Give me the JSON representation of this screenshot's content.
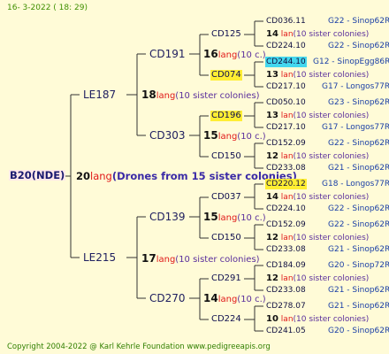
{
  "header": {
    "date": "16-  3-2022 ( 18: 29)"
  },
  "footer": {
    "copyright": "Copyright 2004-2022 @ Karl Kehrle Foundation   www.pedigreeapis.org"
  },
  "root": {
    "label": "B20(NDE)"
  },
  "root_mating": {
    "num": "20",
    "lang": "lang",
    "detail": "(Drones from 15 sister colonies)"
  },
  "parents": {
    "top": {
      "label": "LE187",
      "num": "18",
      "lang": "lang",
      "detail": "(10 sister colonies)"
    },
    "bottom": {
      "label": "LE215",
      "num": "17",
      "lang": "lang",
      "detail": "(10 sister colonies)"
    }
  },
  "grandparents": [
    {
      "label": "CD191",
      "num": "16",
      "lang": "lang",
      "detail": "(10 c.)"
    },
    {
      "label": "CD303",
      "num": "15",
      "lang": "lang",
      "detail": "(10 c.)"
    },
    {
      "label": "CD139",
      "num": "15",
      "lang": "lang",
      "detail": "(10 c.)"
    },
    {
      "label": "CD270",
      "num": "14",
      "lang": "lang",
      "detail": "(10 c.)"
    }
  ],
  "great_grandparents": [
    {
      "label": "CD125",
      "num": "14",
      "lang": "lan",
      "detail": "(10 sister colonies)"
    },
    {
      "label": "CD074",
      "num": "13",
      "lang": "lan",
      "detail": "(10 sister colonies)"
    },
    {
      "label": "CD196",
      "num": "13",
      "lang": "lan",
      "detail": "(10 sister colonies)"
    },
    {
      "label": "CD150",
      "num": "12",
      "lang": "lan",
      "detail": "(10 sister colonies)"
    },
    {
      "label": "CD037",
      "num": "14",
      "lang": "lan",
      "detail": "(10 sister colonies)"
    },
    {
      "label": "CD150",
      "num": "12",
      "lang": "lan",
      "detail": "(10 sister colonies)"
    },
    {
      "label": "CD291",
      "num": "12",
      "lang": "lan",
      "detail": "(10 sister colonies)"
    },
    {
      "label": "CD224",
      "num": "10",
      "lang": "lan",
      "detail": "(10 sister colonies)"
    }
  ],
  "gen4": [
    {
      "label": "CD036.11",
      "info": "G22 - Sinop62R"
    },
    {
      "label": "CD224.10",
      "info": "G22 - Sinop62R"
    },
    {
      "label": "CD244.10",
      "info": "G12 - SinopEgg86R"
    },
    {
      "label": "CD217.10",
      "info": "G17 - Longos77R"
    },
    {
      "label": "CD050.10",
      "info": "G23 - Sinop62R"
    },
    {
      "label": "CD217.10",
      "info": "G17 - Longos77R"
    },
    {
      "label": "CD152.09",
      "info": "G22 - Sinop62R"
    },
    {
      "label": "CD233.08",
      "info": "G21 - Sinop62R"
    },
    {
      "label": "CD220.12",
      "info": "G18 - Longos77R"
    },
    {
      "label": "CD224.10",
      "info": "G22 - Sinop62R"
    },
    {
      "label": "CD152.09",
      "info": "G22 - Sinop62R"
    },
    {
      "label": "CD233.08",
      "info": "G21 - Sinop62R"
    },
    {
      "label": "CD184.09",
      "info": "G20 - Sinop72R"
    },
    {
      "label": "CD233.08",
      "info": "G21 - Sinop62R"
    },
    {
      "label": "CD278.07",
      "info": "G21 - Sinop62R"
    },
    {
      "label": "CD241.05",
      "info": "G20 - Sinop62R"
    }
  ]
}
